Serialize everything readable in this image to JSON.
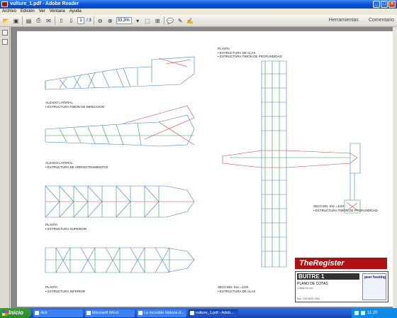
{
  "window": {
    "title": "vulture_1.pdf - Adobe Reader"
  },
  "menu": [
    "Archivo",
    "Edición",
    "Ver",
    "Ventana",
    "Ayuda"
  ],
  "toolbar": {
    "page_current": "1",
    "page_total": "/ 3",
    "zoom": "33,3%",
    "tools_label": "Herramientas",
    "comment_label": "Comentario"
  },
  "drawing": {
    "labels": {
      "alzado1": "ALZADO LATERAL\n• ESTRUCTURA TIMON DE DIRECCION",
      "alzado2": "ALZADO LATERAL\n• ESTRUCTURA DE ARRIOSTRAMIENTOS",
      "planta1": "PLANTA\n• ESTRUCTURA SUPERIOR",
      "planta2": "PLANTA\n• ESTRUCTURA INFERIOR",
      "planta_alas": "PLANTA\n• ESTRUCTURA DE ALAS\n• ESTRUCTURA TIMON DE PROFUNDIDAD",
      "seccion_timon": "SECCION  Esc.=1/20\n• ESTRUCTURA TIMON DE PROFUNDIDAD",
      "seccion_alas": "SECCION  Esc.=1/20\n• ESTRUCTURA DE ALAS"
    },
    "logo": "TheRegister",
    "title_block": {
      "name": "BUITRE 1",
      "subtitle": "PLANO DE COTAS",
      "scale": "Cotas en cm.",
      "footer": "Esc. 1/20                    NOV. 2011",
      "badge": "peer hosting"
    }
  },
  "taskbar": {
    "start": "Inicio",
    "tasks": [
      "dick",
      "Microsoft Word",
      "La increible historia d...",
      "vulture_1.pdf - Adob..."
    ],
    "active_index": 3,
    "clock": "11:20"
  },
  "colors": {
    "structure_blue": "#3a7fd0",
    "structure_green": "#2a9a4a",
    "structure_red": "#d04040",
    "brand_red": "#b01010"
  }
}
